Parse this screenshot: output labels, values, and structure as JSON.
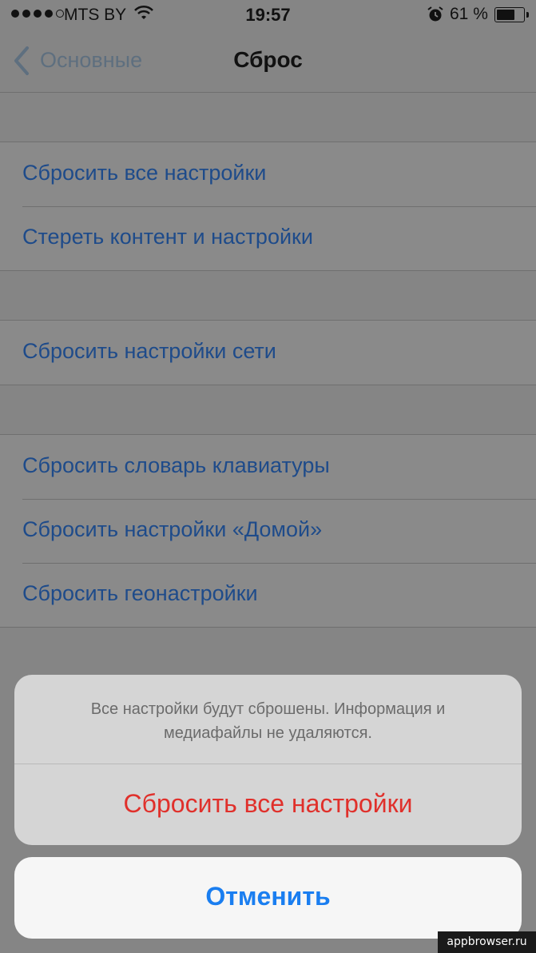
{
  "status_bar": {
    "carrier": "MTS BY",
    "time": "19:57",
    "battery_percent": "61 %",
    "battery_level": 0.61,
    "signal_bars": 4
  },
  "nav": {
    "back_label": "Основные",
    "title": "Сброс"
  },
  "groups": [
    {
      "items": [
        "Сбросить все настройки",
        "Стереть контент и настройки"
      ]
    },
    {
      "items": [
        "Сбросить настройки сети"
      ]
    },
    {
      "items": [
        "Сбросить словарь клавиатуры",
        "Сбросить настройки «Домой»",
        "Сбросить геонастройки"
      ]
    }
  ],
  "action_sheet": {
    "message": "Все настройки будут сброшены. Информация и медиафайлы не удаляются.",
    "destructive_label": "Сбросить все настройки",
    "cancel_label": "Отменить"
  },
  "watermark": "appbrowser.ru",
  "colors": {
    "link_blue": "#1e4b8a",
    "destructive_red": "#e0302b",
    "cancel_blue": "#1a7ef0"
  }
}
